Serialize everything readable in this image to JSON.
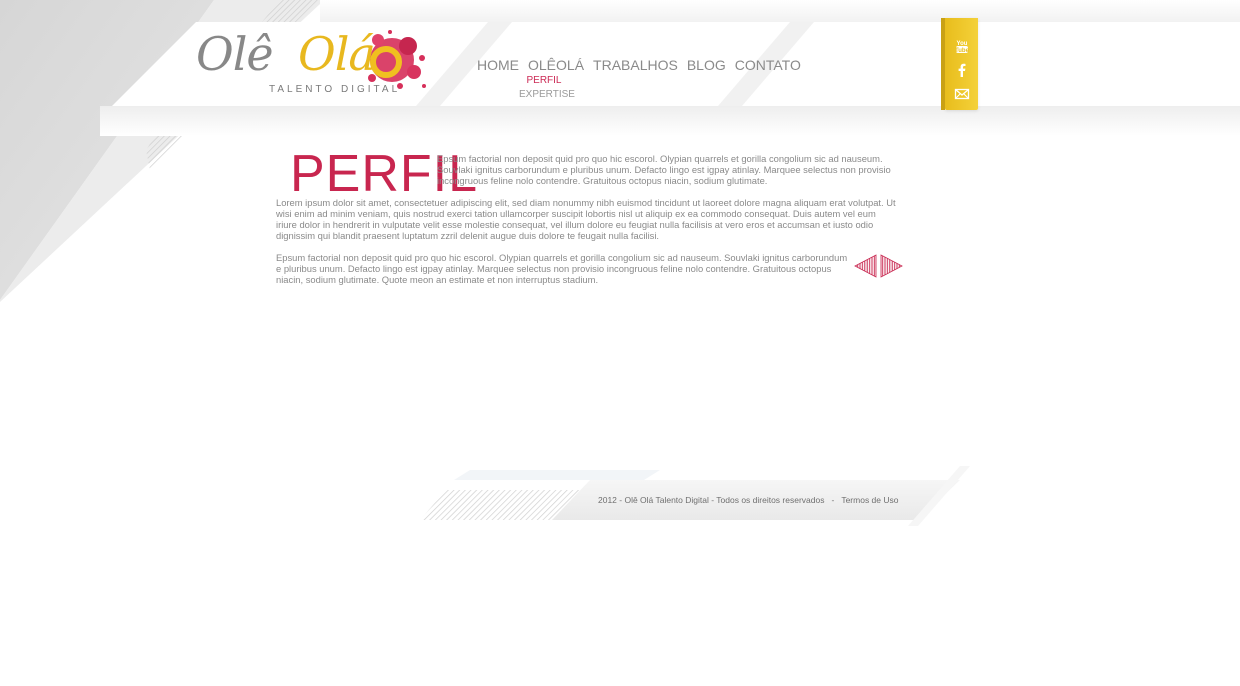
{
  "brand": {
    "logo_word1": "Olê",
    "logo_word2": "Olá",
    "tagline": "TALENTO DIGITAL",
    "accent_color": "#c8264f",
    "yellow_color": "#e8bd1c"
  },
  "nav": {
    "items": [
      {
        "label": "HOME"
      },
      {
        "label": "OLÊOLÁ"
      },
      {
        "label": "TRABALHOS"
      },
      {
        "label": "BLOG"
      },
      {
        "label": "CONTATO"
      }
    ],
    "subitems": [
      {
        "label": "PERFIL",
        "active": true
      },
      {
        "label": "EXPERTISE",
        "active": false
      }
    ]
  },
  "social": {
    "icons": [
      "youtube-icon",
      "facebook-icon",
      "email-icon"
    ]
  },
  "content": {
    "heading": "PERFIL",
    "paragraphs": [
      "Epsum factorial non deposit quid pro quo hic escorol. Olypian quarrels et gorilla congolium sic ad nauseum. Souvlaki ignitus carborundum e pluribus unum. Defacto lingo est igpay atinlay. Marquee selectus non provisio incongruous feline nolo contendre. Gratuitous octopus niacin, sodium glutimate.",
      "Lorem ipsum dolor sit amet, consectetuer adipiscing elit, sed diam nonummy nibh euismod tincidunt ut laoreet dolore magna aliquam erat volutpat. Ut wisi enim ad minim veniam, quis nostrud exerci tation ullamcorper suscipit lobortis nisl ut aliquip ex ea commodo consequat. Duis autem vel eum iriure dolor in hendrerit in vulputate velit esse molestie consequat, vel illum dolore eu feugiat nulla facilisis at vero eros et accumsan et iusto odio dignissim qui blandit praesent luptatum zzril delenit augue duis dolore te feugait nulla facilisi.",
      "Epsum factorial non deposit quid pro quo hic escorol. Olypian quarrels et gorilla congolium sic ad nauseum. Souvlaki ignitus carborundum e pluribus unum. Defacto lingo est igpay atinlay. Marquee selectus non provisio incongruous feline nolo contendre. Gratuitous octopus niacin, sodium glutimate. Quote meon an estimate et non interruptus stadium."
    ]
  },
  "footer": {
    "copyright": "2012 - Olê Olá Talento Digital - Todos os direitos reservados",
    "separator": "-",
    "terms_label": "Termos de Uso"
  }
}
